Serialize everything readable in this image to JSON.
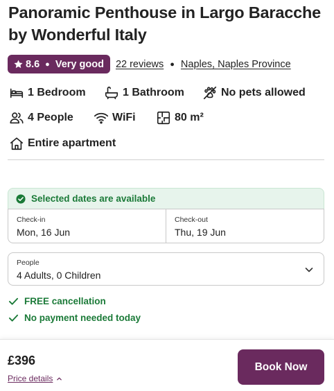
{
  "listing": {
    "title": "Panoramic Penthouse in Largo Baracche by Wonderful Italy",
    "rating_score": "8.6",
    "rating_label": "Very good",
    "reviews_link": "22 reviews",
    "location_link": "Naples, Naples Province"
  },
  "features": [
    {
      "label": "1 Bedroom",
      "icon": "bed-icon"
    },
    {
      "label": "1 Bathroom",
      "icon": "bathtub-icon"
    },
    {
      "label": "No pets allowed",
      "icon": "no-pets-icon"
    },
    {
      "label": "4 People",
      "icon": "people-icon"
    },
    {
      "label": "WiFi",
      "icon": "wifi-icon"
    },
    {
      "label": "80 m²",
      "icon": "floorplan-icon"
    },
    {
      "label": "Entire apartment",
      "icon": "house-icon"
    }
  ],
  "booking": {
    "availability": "Selected dates are available",
    "checkin_label": "Check-in",
    "checkin_value": "Mon, 16 Jun",
    "checkout_label": "Check-out",
    "checkout_value": "Thu, 19 Jun",
    "people_label": "People",
    "people_value": "4 Adults, 0 Children",
    "perks": [
      "FREE cancellation",
      "No payment needed today"
    ]
  },
  "footer": {
    "price": "£396",
    "price_details": "Price details",
    "book_button": "Book Now"
  },
  "colors": {
    "brand": "#6a2a5e",
    "success": "#1b7a38",
    "success_bg": "#e7f4ec"
  }
}
